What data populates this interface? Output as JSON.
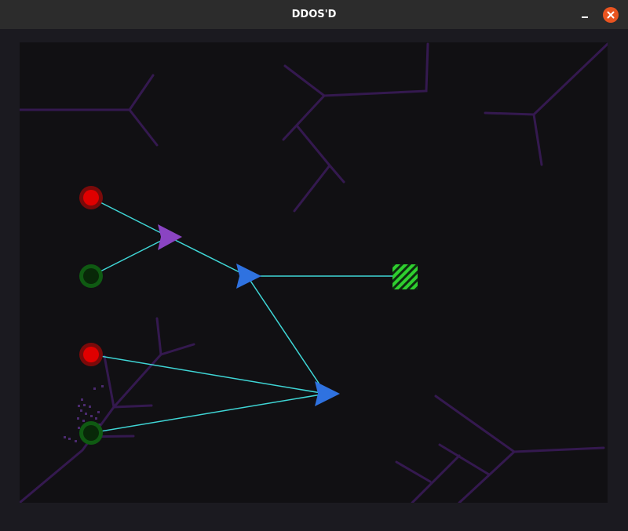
{
  "window": {
    "title": "DDOS'D",
    "minimize_icon": "minimize-icon",
    "close_icon": "close-icon"
  },
  "colors": {
    "titlebar_bg": "#2c2c2c",
    "close_button": "#e95420",
    "board_bg": "#111013",
    "frame_bg": "#1b1a20",
    "crack": "#34194f",
    "connection": "#3fd6d6",
    "node_red": "#e00000",
    "node_red_ring": "#7a0a0a",
    "node_green": "#0c3a0c",
    "node_green_ring": "#0f5a12",
    "router_purple": "#8a44c2",
    "router_blue": "#2f72e0",
    "server_green": "#2fcf2f"
  },
  "game": {
    "sources": [
      {
        "id": "source-1",
        "state": "red"
      },
      {
        "id": "source-2",
        "state": "green"
      },
      {
        "id": "source-3",
        "state": "red"
      },
      {
        "id": "source-4",
        "state": "green"
      }
    ],
    "routers": [
      {
        "id": "router-1",
        "color": "purple"
      },
      {
        "id": "router-2",
        "color": "blue"
      },
      {
        "id": "router-3",
        "color": "blue"
      }
    ],
    "target": {
      "id": "server",
      "pattern": "striped",
      "color": "green"
    }
  }
}
